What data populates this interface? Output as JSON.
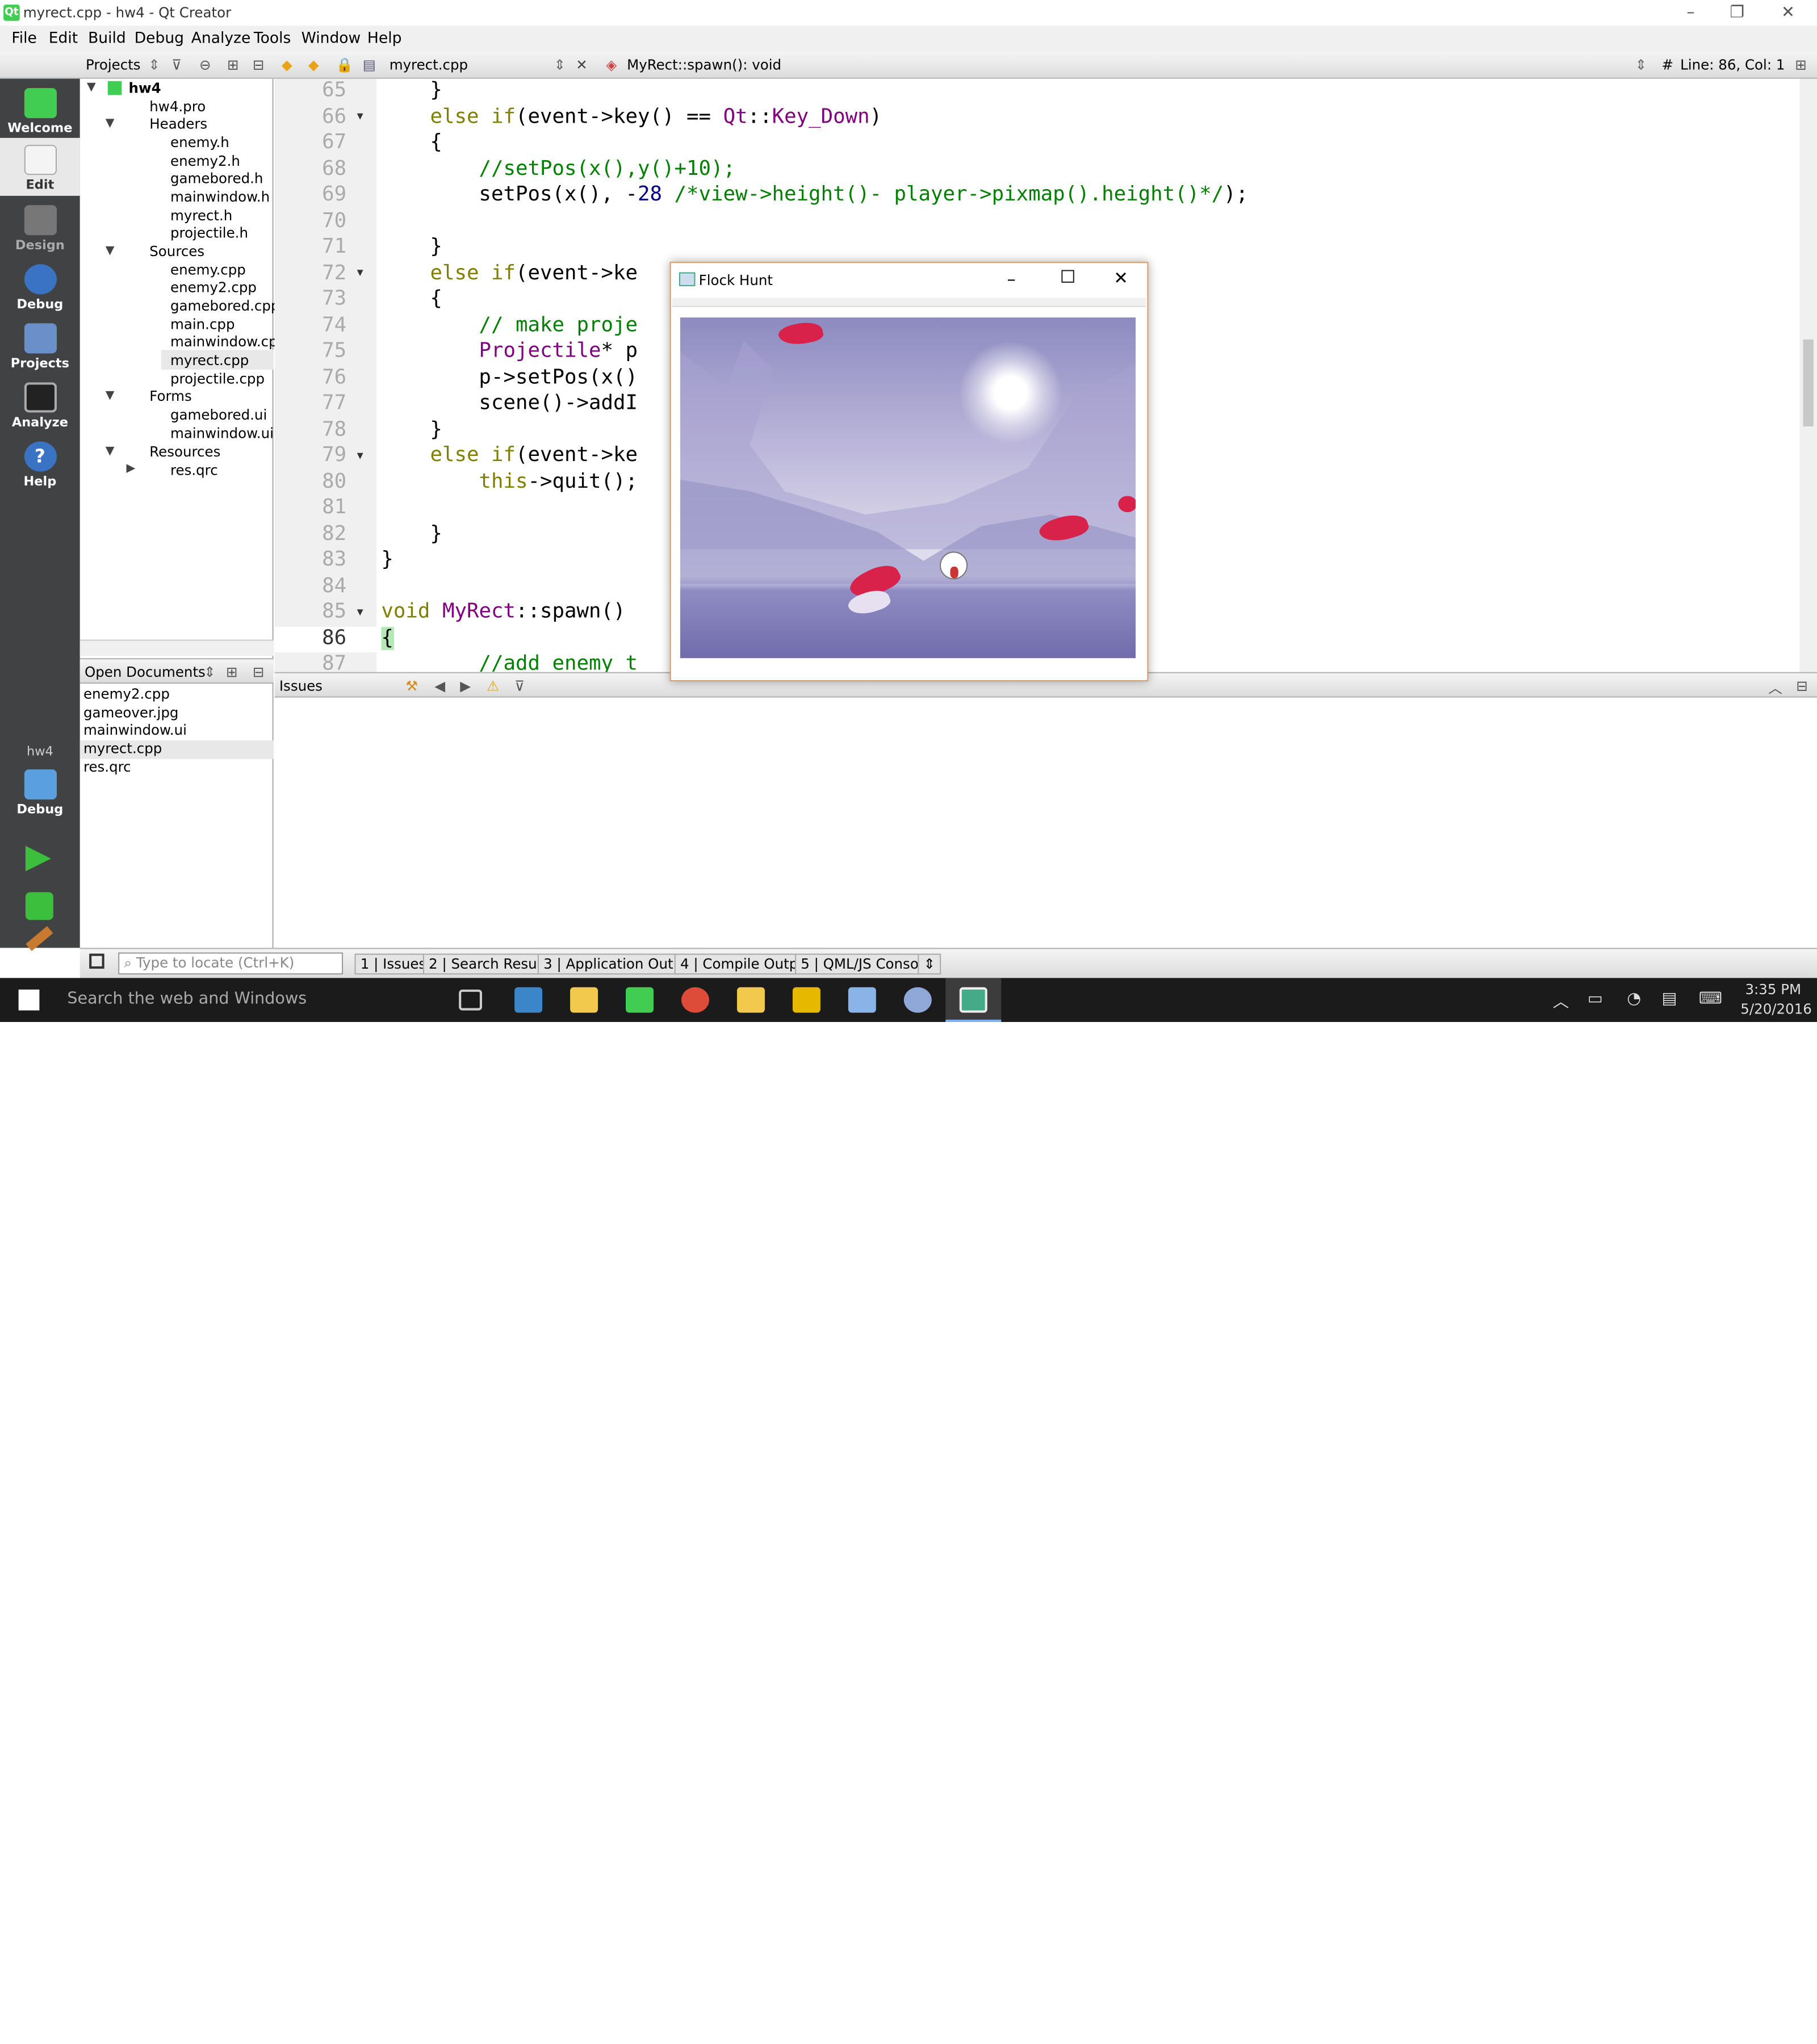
{
  "window": {
    "title": "myrect.cpp - hw4 - Qt Creator",
    "minimize": "–",
    "restore": "❐",
    "close": "✕"
  },
  "menu": [
    "File",
    "Edit",
    "Build",
    "Debug",
    "Analyze",
    "Tools",
    "Window",
    "Help"
  ],
  "toolbar": {
    "projects_combo": "Projects",
    "file_combo": "myrect.cpp",
    "function_combo": "MyRect::spawn(): void",
    "hash": "#",
    "position": "Line: 86, Col: 1"
  },
  "modes": [
    "Welcome",
    "Edit",
    "Design",
    "Debug",
    "Projects",
    "Analyze",
    "Help"
  ],
  "kit": {
    "project": "hw4",
    "mode": "Debug"
  },
  "tree": {
    "root": "hw4",
    "pro": "hw4.pro",
    "headers_label": "Headers",
    "headers": [
      "enemy.h",
      "enemy2.h",
      "gamebored.h",
      "mainwindow.h",
      "myrect.h",
      "projectile.h"
    ],
    "sources_label": "Sources",
    "sources": [
      "enemy.cpp",
      "enemy2.cpp",
      "gamebored.cpp",
      "main.cpp",
      "mainwindow.cpp",
      "myrect.cpp",
      "projectile.cpp"
    ],
    "forms_label": "Forms",
    "forms": [
      "gamebored.ui",
      "mainwindow.ui"
    ],
    "resources_label": "Resources",
    "resources": [
      "res.qrc"
    ]
  },
  "open_documents": {
    "label": "Open Documents",
    "files": [
      "enemy2.cpp",
      "gameover.jpg",
      "mainwindow.ui",
      "myrect.cpp",
      "res.qrc"
    ]
  },
  "code_lines": [
    "65",
    "66",
    "67",
    "68",
    "69",
    "70",
    "71",
    "72",
    "73",
    "74",
    "75",
    "76",
    "77",
    "78",
    "79",
    "80",
    "81",
    "82",
    "83",
    "84",
    "85",
    "86",
    "87"
  ],
  "issues": {
    "label": "Issues"
  },
  "locator": {
    "placeholder": "Type to locate (Ctrl+K)"
  },
  "output_tabs": [
    {
      "n": "1",
      "label": "Issues"
    },
    {
      "n": "2",
      "label": "Search Results"
    },
    {
      "n": "3",
      "label": "Application Output"
    },
    {
      "n": "4",
      "label": "Compile Output"
    },
    {
      "n": "5",
      "label": "QML/JS Console"
    }
  ],
  "popup": {
    "title": "Flock Hunt"
  },
  "taskbar": {
    "search": "Search the web and Windows",
    "time": "3:35 PM",
    "date": "5/20/2016"
  },
  "colors": {
    "mode_bar": "#404244",
    "keyword": "#808000",
    "type": "#800080",
    "comment": "#008000",
    "number": "#000080"
  }
}
